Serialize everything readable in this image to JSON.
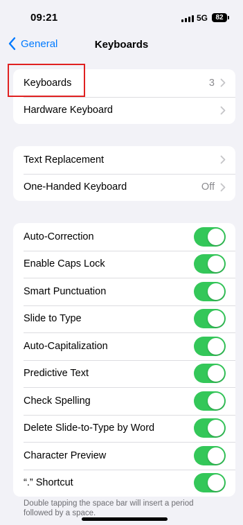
{
  "status_bar": {
    "time": "09:21",
    "network": "5G",
    "battery": "82"
  },
  "nav": {
    "back_label": "General",
    "title": "Keyboards"
  },
  "group1": [
    {
      "label": "Keyboards",
      "detail": "3"
    },
    {
      "label": "Hardware Keyboard",
      "detail": ""
    }
  ],
  "group2": [
    {
      "label": "Text Replacement",
      "detail": ""
    },
    {
      "label": "One-Handed Keyboard",
      "detail": "Off"
    }
  ],
  "toggles": [
    {
      "label": "Auto-Correction",
      "on": true
    },
    {
      "label": "Enable Caps Lock",
      "on": true
    },
    {
      "label": "Smart Punctuation",
      "on": true
    },
    {
      "label": "Slide to Type",
      "on": true
    },
    {
      "label": "Auto-Capitalization",
      "on": true
    },
    {
      "label": "Predictive Text",
      "on": true
    },
    {
      "label": "Check Spelling",
      "on": true
    },
    {
      "label": "Delete Slide-to-Type by Word",
      "on": true
    },
    {
      "label": "Character Preview",
      "on": true
    },
    {
      "label": "“.” Shortcut",
      "on": true
    }
  ],
  "footer_note": "Double tapping the space bar will insert a period followed by a space.",
  "colors": {
    "accent": "#007aff",
    "toggle_on": "#34c759",
    "highlight": "#e02020",
    "background": "#f2f2f7"
  },
  "icons": {
    "back": "chevron-left-icon",
    "disclosure": "chevron-right-icon"
  }
}
